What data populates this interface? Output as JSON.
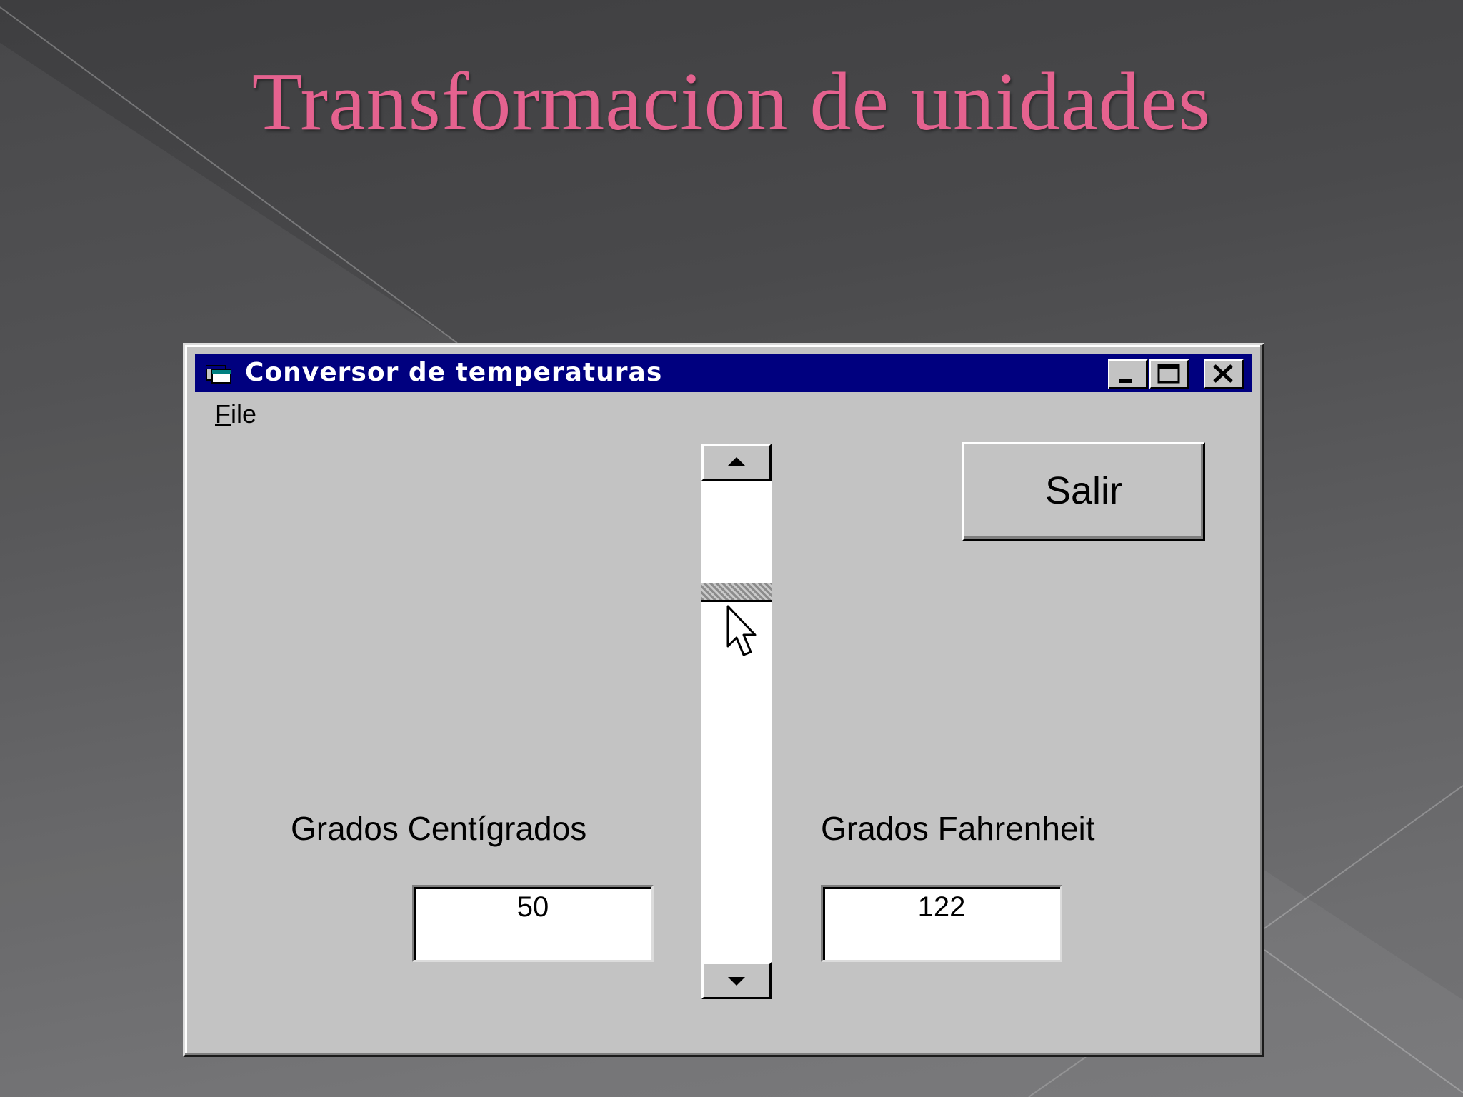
{
  "slide": {
    "title": "Transformacion de unidades"
  },
  "window": {
    "title": "Conversor de temperaturas",
    "menu": {
      "file_label": "File"
    },
    "salir_label": "Salir",
    "scrollbar": {
      "value_fraction": 0.22
    },
    "celsius": {
      "label": "Grados Centígrados",
      "value": "50"
    },
    "fahrenheit": {
      "label": "Grados Fahrenheit",
      "value": "122"
    }
  },
  "colors": {
    "title_pink": "#e5628f",
    "titlebar_blue": "#00007f",
    "window_gray": "#c3c3c3"
  },
  "icons": [
    "app-window-icon",
    "minimize-icon",
    "maximize-icon",
    "close-icon",
    "arrow-up-icon",
    "arrow-down-icon",
    "mouse-pointer-icon"
  ]
}
